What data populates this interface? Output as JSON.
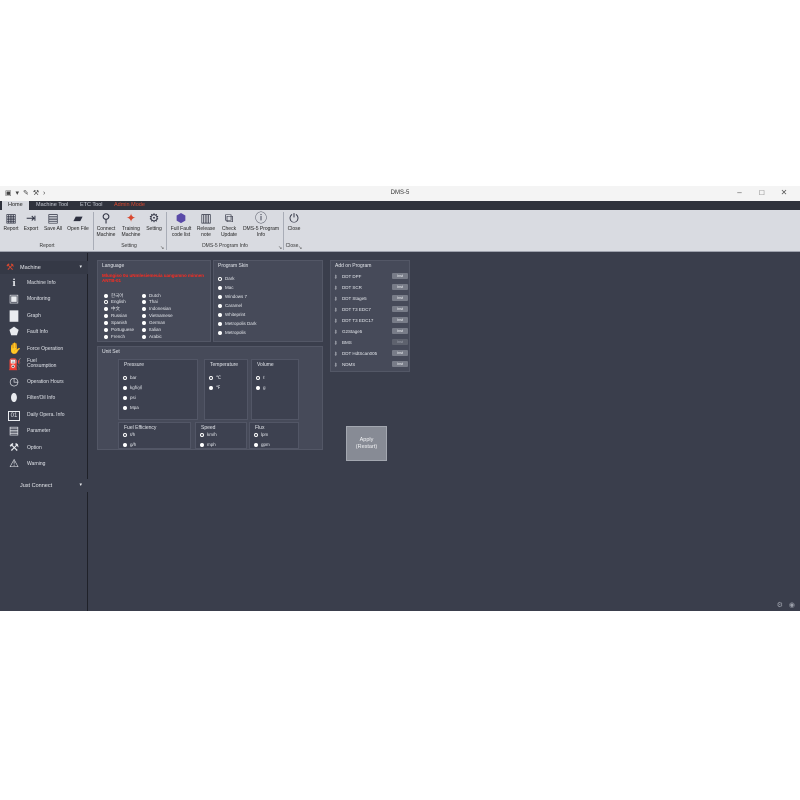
{
  "window": {
    "title": "DMS-5",
    "quick_access": "▣ ▾ ✎ ⚒ ›",
    "controls": [
      "–",
      "□",
      "✕"
    ]
  },
  "tabs": [
    {
      "label": "Home",
      "active": true
    },
    {
      "label": "Machine Tool",
      "active": false
    },
    {
      "label": "ETC Tool",
      "active": false
    },
    {
      "label": "Admin Mode",
      "active": false,
      "alert": true
    }
  ],
  "ribbon": {
    "buttons": [
      {
        "label": "Report",
        "icon": "report-icon",
        "glyph": "▦"
      },
      {
        "label": "Export",
        "icon": "export-icon",
        "glyph": "⇥"
      },
      {
        "label": "Save All",
        "icon": "save-icon",
        "glyph": "▤"
      },
      {
        "label": "Open File",
        "icon": "folder-icon",
        "glyph": "▰"
      },
      {
        "label": "Connect\nMachine",
        "icon": "search-icon",
        "glyph": "⚲"
      },
      {
        "label": "Training\nMachine",
        "icon": "training-icon",
        "glyph": "✦"
      },
      {
        "label": "Setting",
        "icon": "gear-icon",
        "glyph": "⚙"
      },
      {
        "label": "Full Fault\ncode list",
        "icon": "hex-icon",
        "glyph": "⬢"
      },
      {
        "label": "Release\nnote",
        "icon": "document-icon",
        "glyph": "▥"
      },
      {
        "label": "Check\nUpdate",
        "icon": "update-icon",
        "glyph": "⧉"
      },
      {
        "label": "DMS-5 Program\nInfo",
        "icon": "info-icon",
        "glyph": "ⓘ"
      },
      {
        "label": "Close",
        "icon": "power-icon",
        "glyph": "⏻"
      }
    ],
    "groups": [
      "Report",
      "Setting",
      "DMS-5 Program Info",
      "Close"
    ]
  },
  "sidebar": {
    "header": "Machine",
    "items": [
      {
        "label": "Machine Info",
        "icon": "info-icon",
        "glyph": "i"
      },
      {
        "label": "Monitoring",
        "icon": "monitor-icon",
        "glyph": "▣"
      },
      {
        "label": "Graph",
        "icon": "graph-icon",
        "glyph": "▇"
      },
      {
        "label": "Fault Info",
        "icon": "engine-icon",
        "glyph": "⬟"
      },
      {
        "label": "Force Operation",
        "icon": "hand-icon",
        "glyph": "✋"
      },
      {
        "label": "Fuel\nConsumption",
        "icon": "fuel-icon",
        "glyph": "⛽"
      },
      {
        "label": "Operation Hours",
        "icon": "clock-icon",
        "glyph": "◷"
      },
      {
        "label": "Filter/Oil Info",
        "icon": "oil-icon",
        "glyph": "⬮"
      },
      {
        "label": "Daily Opera. Info",
        "icon": "calendar-icon",
        "glyph": "01"
      },
      {
        "label": "Parameter",
        "icon": "parameter-icon",
        "glyph": "▤"
      },
      {
        "label": "Option",
        "icon": "tools-icon",
        "glyph": "⚒"
      },
      {
        "label": "Warning",
        "icon": "warning-icon",
        "glyph": "⚠"
      }
    ],
    "footer": "Just Connect"
  },
  "language": {
    "title": "Language",
    "warning": "Mlungiso 0u uNmlesiemeuia uangumno minnen ANTB-01",
    "options_col1": [
      "한국어",
      "English",
      "中文",
      "Russian",
      "Spanish",
      "Portuguese",
      "French"
    ],
    "options_col2": [
      "Dutch",
      "Thai",
      "Indonesian",
      "Vietnamese",
      "German",
      "Italian",
      "Arabic"
    ],
    "selected": "English"
  },
  "skin": {
    "title": "Program Skin",
    "options": [
      "Dark",
      "Mac",
      "Windows 7",
      "Caramel",
      "Whiteprint",
      "Metropolis Dark",
      "Metropolis"
    ],
    "selected": "Dark"
  },
  "addon": {
    "title": "Add on Program",
    "items": [
      {
        "name": "DDT DPF",
        "install": "Inst",
        "enabled": true
      },
      {
        "name": "DDT SCR",
        "install": "Inst",
        "enabled": true
      },
      {
        "name": "DDT Stage5",
        "install": "Inst",
        "enabled": true
      },
      {
        "name": "DDT T3 EDC7",
        "install": "Inst",
        "enabled": true
      },
      {
        "name": "DDT T3 EDC17",
        "install": "Inst",
        "enabled": true
      },
      {
        "name": "G2Stage5",
        "install": "Inst",
        "enabled": true
      },
      {
        "name": "BMS",
        "install": "Inst",
        "enabled": false
      },
      {
        "name": "DDT HdtScan005",
        "install": "Inst",
        "enabled": true
      },
      {
        "name": "NDMS",
        "install": "Inst",
        "enabled": true
      }
    ]
  },
  "unitset": {
    "title": "Unit Set",
    "pressure": {
      "title": "Pressure",
      "options": [
        "bar",
        "kgf/㎠",
        "psi",
        "Mpa"
      ]
    },
    "temperature": {
      "title": "Temperature",
      "options": [
        "℃",
        "℉"
      ]
    },
    "volume": {
      "title": "Volume",
      "options": [
        "ℓ",
        "g"
      ]
    },
    "fuel": {
      "title": "Fuel Efficiency",
      "options": [
        "ℓ/h",
        "g/h"
      ]
    },
    "speed": {
      "title": "Speed",
      "options": [
        "km/h",
        "mph"
      ]
    },
    "flux": {
      "title": "Flux",
      "options": [
        "lpm",
        "gpm"
      ]
    }
  },
  "apply_label": "Apply\n(Restart)",
  "colors": {
    "background": "#3a3e4c",
    "panel": "#464a59",
    "accent_red": "#d9482f"
  }
}
